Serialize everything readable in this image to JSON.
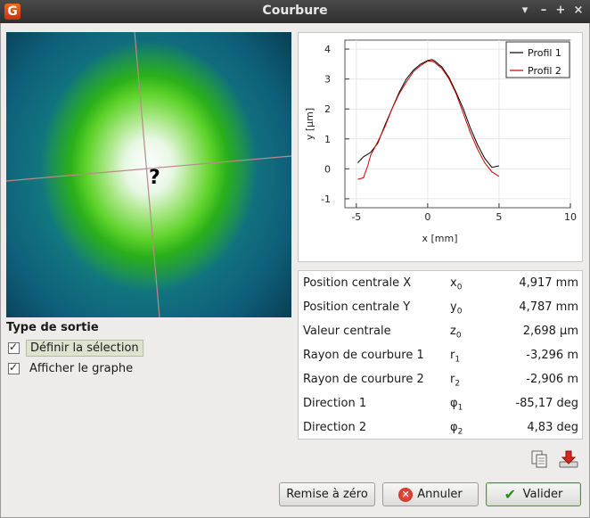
{
  "window": {
    "title": "Courbure",
    "controls": [
      "▾",
      "–",
      "+",
      "×"
    ],
    "icon": "gwyddion-logo"
  },
  "graph": {
    "xlabel": "x [mm]",
    "ylabel": "y [μm]",
    "xticks": [
      "-5",
      "0",
      "5",
      "10"
    ],
    "yticks": [
      "-1",
      "0",
      "1",
      "2",
      "3",
      "4"
    ],
    "legend": [
      "Profil 1",
      "Profil 2"
    ]
  },
  "chart_data": {
    "type": "line",
    "xlabel": "x [mm]",
    "ylabel": "y [μm]",
    "xlim": [
      -5.8,
      10
    ],
    "ylim": [
      -1.3,
      4.3
    ],
    "grid": true,
    "legend_position": "top-right",
    "series": [
      {
        "name": "Profil 1",
        "color": "#000000",
        "x": [
          -4.9,
          -4.5,
          -4.0,
          -3.5,
          -3.0,
          -2.5,
          -2.0,
          -1.5,
          -1.0,
          -0.5,
          0.0,
          0.3,
          0.5,
          1.0,
          1.5,
          2.0,
          2.5,
          3.0,
          3.5,
          4.0,
          4.5,
          5.0
        ],
        "y": [
          0.2,
          0.4,
          0.55,
          0.85,
          1.45,
          2.0,
          2.55,
          3.0,
          3.3,
          3.5,
          3.62,
          3.65,
          3.6,
          3.4,
          3.05,
          2.55,
          2.0,
          1.35,
          0.8,
          0.35,
          0.05,
          0.1
        ]
      },
      {
        "name": "Profil 2",
        "color": "#cc0000",
        "x": [
          -4.9,
          -4.5,
          -4.2,
          -4.0,
          -3.5,
          -3.0,
          -2.5,
          -2.0,
          -1.5,
          -1.0,
          -0.5,
          0.0,
          0.3,
          0.5,
          1.0,
          1.5,
          2.0,
          2.5,
          3.0,
          3.5,
          4.0,
          4.5,
          5.0
        ],
        "y": [
          -0.35,
          -0.3,
          0.1,
          0.45,
          0.9,
          1.4,
          2.0,
          2.5,
          2.9,
          3.25,
          3.45,
          3.6,
          3.6,
          3.55,
          3.35,
          3.0,
          2.5,
          1.85,
          1.2,
          0.65,
          0.2,
          -0.1,
          -0.25
        ]
      }
    ]
  },
  "results": [
    {
      "label": "Position centrale X",
      "sym": "x",
      "sub": "0",
      "value": "4,917 mm"
    },
    {
      "label": "Position centrale Y",
      "sym": "y",
      "sub": "0",
      "value": "4,787 mm"
    },
    {
      "label": "Valeur centrale",
      "sym": "z",
      "sub": "0",
      "value": "2,698 μm"
    },
    {
      "label": "Rayon de courbure 1",
      "sym": "r",
      "sub": "1",
      "value": "-3,296 m"
    },
    {
      "label": "Rayon de courbure 2",
      "sym": "r",
      "sub": "2",
      "value": "-2,906 m"
    },
    {
      "label": "Direction 1",
      "sym": "φ",
      "sub": "1",
      "value": "-85,17 deg"
    },
    {
      "label": "Direction 2",
      "sym": "φ",
      "sub": "2",
      "value": "4,83 deg"
    }
  ],
  "output": {
    "title": "Type de sortie",
    "define_selection": "Définir la sélection",
    "show_graph": "Afficher le graphe",
    "define_selection_checked": true,
    "show_graph_checked": true
  },
  "buttons": {
    "reset": "Remise à zéro",
    "cancel": "Annuler",
    "ok": "Valider"
  },
  "image": {
    "cursor_glyph": "?"
  }
}
